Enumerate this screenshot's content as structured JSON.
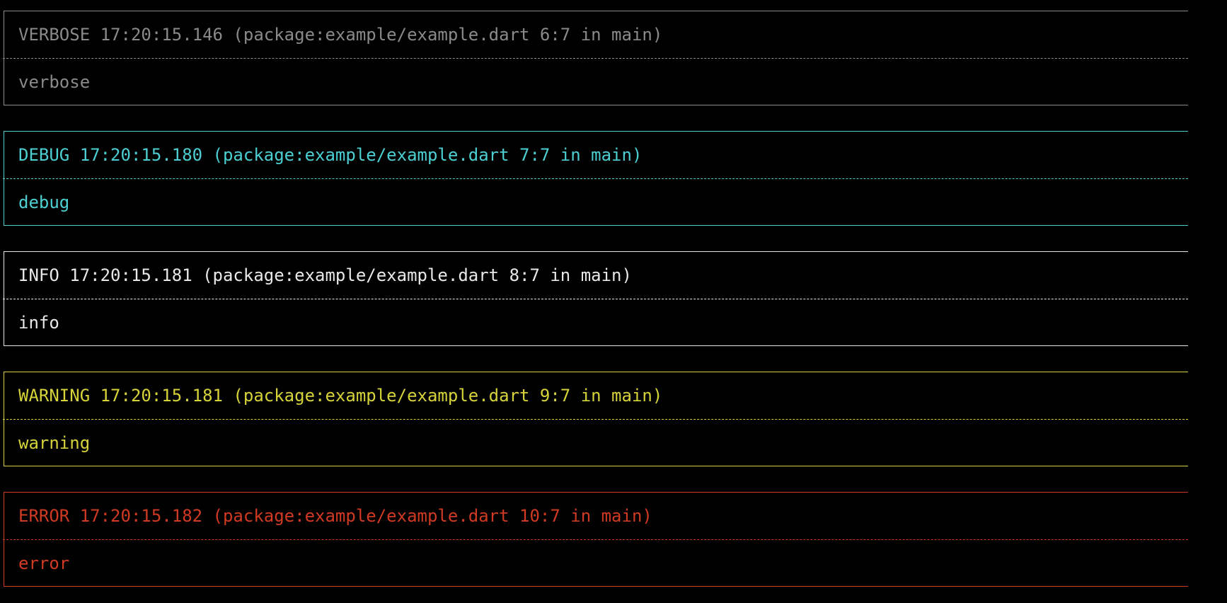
{
  "terminal": {
    "entries": [
      {
        "level": "verbose",
        "color": "#8a8a8a",
        "header": "VERBOSE 17:20:15.146 (package:example/example.dart 6:7 in main)",
        "message": "verbose"
      },
      {
        "level": "debug",
        "color": "#4ccfd3",
        "header": "DEBUG 17:20:15.180 (package:example/example.dart 7:7 in main)",
        "message": "debug"
      },
      {
        "level": "info",
        "color": "#e8e8e8",
        "header": "INFO 17:20:15.181 (package:example/example.dart 8:7 in main)",
        "message": "info"
      },
      {
        "level": "warning",
        "color": "#d6d33a",
        "header": "WARNING 17:20:15.181 (package:example/example.dart 9:7 in main)",
        "message": "warning"
      },
      {
        "level": "error",
        "color": "#d03a22",
        "header": "ERROR 17:20:15.182 (package:example/example.dart 10:7 in main)",
        "message": "error"
      }
    ]
  }
}
